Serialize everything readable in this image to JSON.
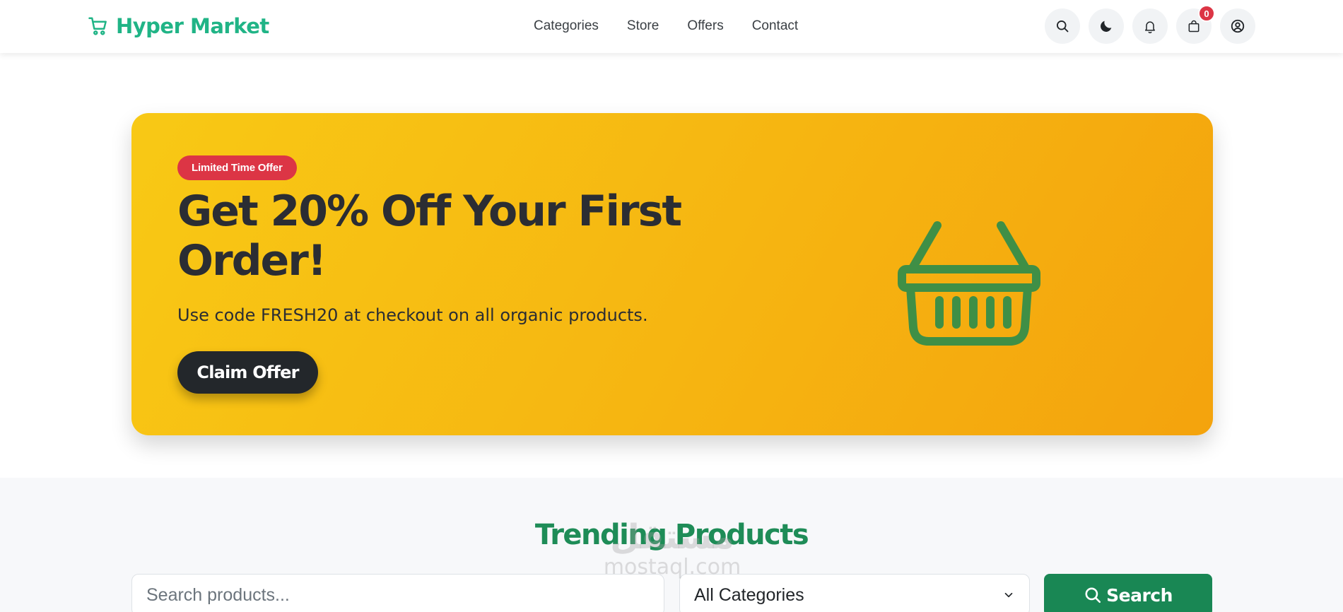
{
  "header": {
    "brand": "Hyper Market",
    "nav": [
      {
        "label": "Categories"
      },
      {
        "label": "Store"
      },
      {
        "label": "Offers"
      },
      {
        "label": "Contact"
      }
    ],
    "cart_count": "0",
    "icons": [
      "search-icon",
      "moon-icon",
      "bell-icon",
      "shopping-bag-icon",
      "user-icon"
    ]
  },
  "hero": {
    "badge": "Limited Time Offer",
    "title": "Get 20% Off Your First Order!",
    "subtitle": "Use code FRESH20 at checkout on all organic products.",
    "cta": "Claim Offer",
    "illustration": "basket-icon"
  },
  "trending": {
    "title": "Trending Products",
    "search_placeholder": "Search products...",
    "category_selected": "All Categories",
    "search_button": "Search"
  },
  "watermark": {
    "arabic": "مستقل",
    "latin": "mostaql.com"
  },
  "colors": {
    "brand": "#20b486",
    "hero_start": "#f8c915",
    "hero_end": "#f4a30d",
    "badge": "#dc3545",
    "search_button": "#198754",
    "basket": "#3f8f46"
  }
}
